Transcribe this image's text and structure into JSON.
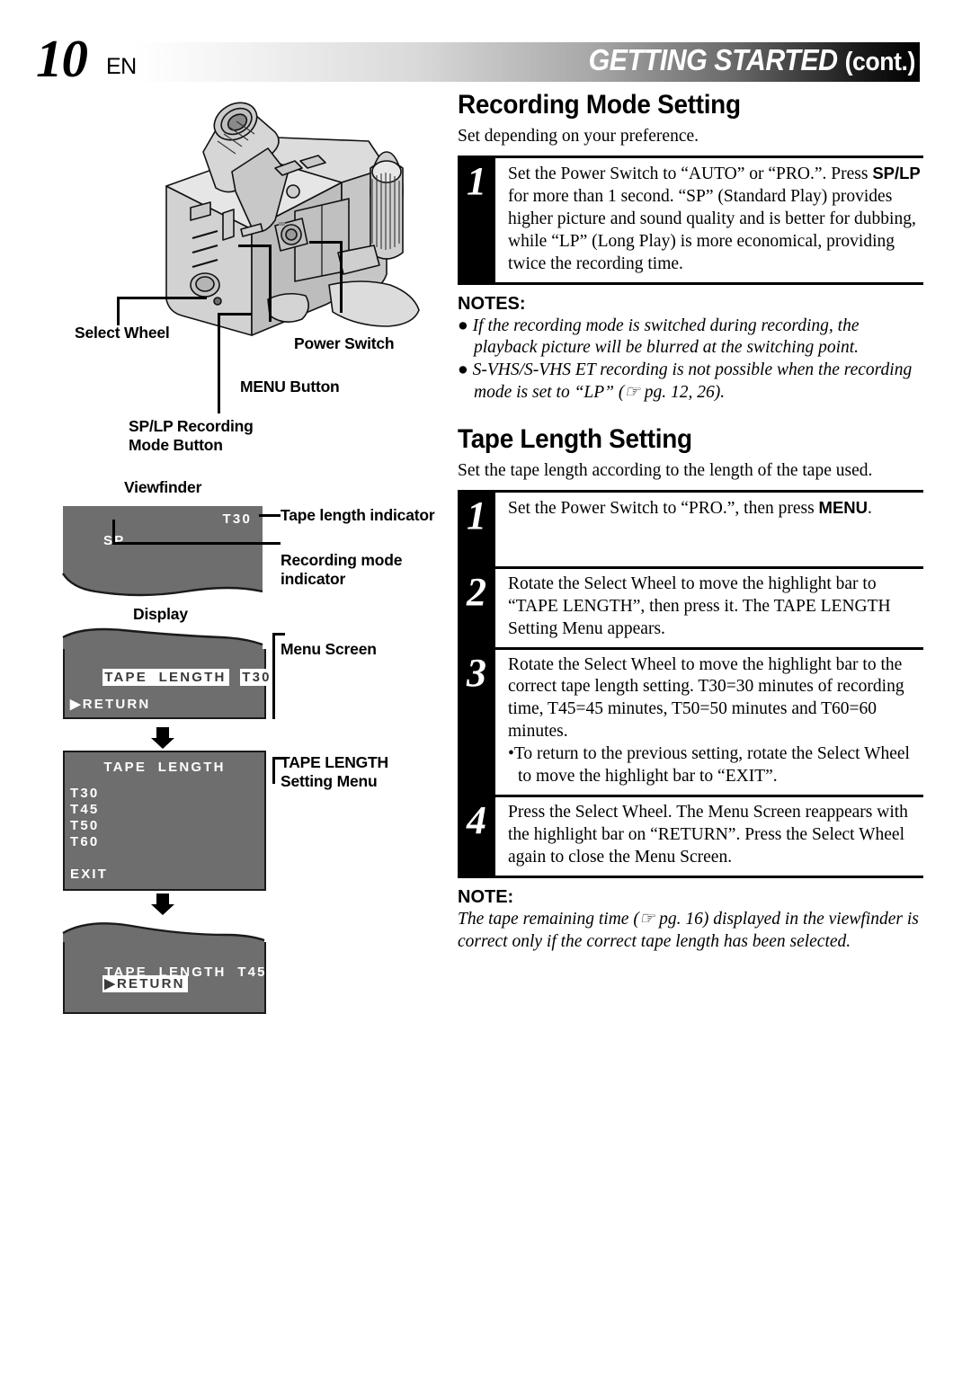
{
  "header": {
    "page_number": "10",
    "region": "EN",
    "title": "GETTING STARTED",
    "title_suffix": "(cont.)"
  },
  "left_column": {
    "callouts": [
      {
        "name": "select-wheel",
        "label": "Select Wheel"
      },
      {
        "name": "power-switch",
        "label": "Power Switch"
      },
      {
        "name": "menu-button",
        "label": "MENU Button"
      },
      {
        "name": "sp-lp-recording-mode-button",
        "label": "SP/LP Recording\nMode Button"
      },
      {
        "name": "viewfinder",
        "label": "Viewfinder"
      },
      {
        "name": "display",
        "label": "Display"
      }
    ],
    "viewfinder_screen": {
      "tape_length_value": "T30",
      "recording_mode_value": "SP",
      "annotation_tape": "Tape length indicator",
      "annotation_mode": "Recording mode\nindicator"
    },
    "menu_screen": {
      "row_label": "TAPE  LENGTH",
      "row_value": "T30",
      "return_label": "▶RETURN",
      "annotation": "Menu Screen"
    },
    "setting_menu": {
      "title": "TAPE  LENGTH",
      "options": [
        "T30",
        "T45",
        "T50",
        "T60"
      ],
      "exit_label": "EXIT",
      "annotation": "TAPE LENGTH\nSetting Menu"
    },
    "menu_screen_after": {
      "row_label": "TAPE  LENGTH",
      "row_value": "T45",
      "return_label": "▶RETURN"
    }
  },
  "right_column": {
    "section1": {
      "title": "Recording Mode Setting",
      "intro": "Set depending on your preference.",
      "steps": [
        {
          "number": "1",
          "text_before": "Set the Power Switch to “AUTO” or “PRO.”. Press ",
          "bold": "SP/LP",
          "text_after": " for more than 1 second. “SP” (Standard Play) provides higher picture and sound quality and is better for dubbing, while “LP” (Long Play) is more economical, providing twice the recording time."
        }
      ],
      "notes_heading": "NOTES:",
      "notes": [
        "If the recording mode is switched during recording, the playback picture will be blurred at the switching point.",
        "S-VHS/S-VHS ET recording is not possible when the recording mode is set to “LP” (☞ pg. 12, 26)."
      ]
    },
    "section2": {
      "title": "Tape Length Setting",
      "intro": "Set the tape length according to the length of the tape used.",
      "steps": [
        {
          "number": "1",
          "text_before": "Set the Power Switch to “PRO.”, then press ",
          "bold": "MENU",
          "text_after": "."
        },
        {
          "number": "2",
          "text_before": "Rotate the Select Wheel to move the highlight bar to “TAPE LENGTH”, then press it. The TAPE LENGTH Setting Menu appears.",
          "bold": "",
          "text_after": ""
        },
        {
          "number": "3",
          "text_before": "Rotate the Select Wheel to move the highlight bar to the correct tape length setting. T30=30 minutes of recording time, T45=45 minutes, T50=50 minutes and T60=60 minutes.",
          "bold": "",
          "text_after": "",
          "sub": "•To return to the previous setting, rotate the Select Wheel to move the highlight bar to “EXIT”."
        },
        {
          "number": "4",
          "text_before": "Press the Select Wheel. The Menu Screen reappears with the highlight bar on “RETURN”. Press the Select Wheel again to close the Menu Screen.",
          "bold": "",
          "text_after": ""
        }
      ],
      "notes_heading": "NOTE:",
      "note_text": "The tape remaining time (☞ pg. 16) displayed in the viewfinder is correct only if the correct tape length has been selected."
    }
  },
  "colors": {
    "screen_gray": "#6e6e6e",
    "ink": "#000000",
    "paper": "#ffffff"
  }
}
